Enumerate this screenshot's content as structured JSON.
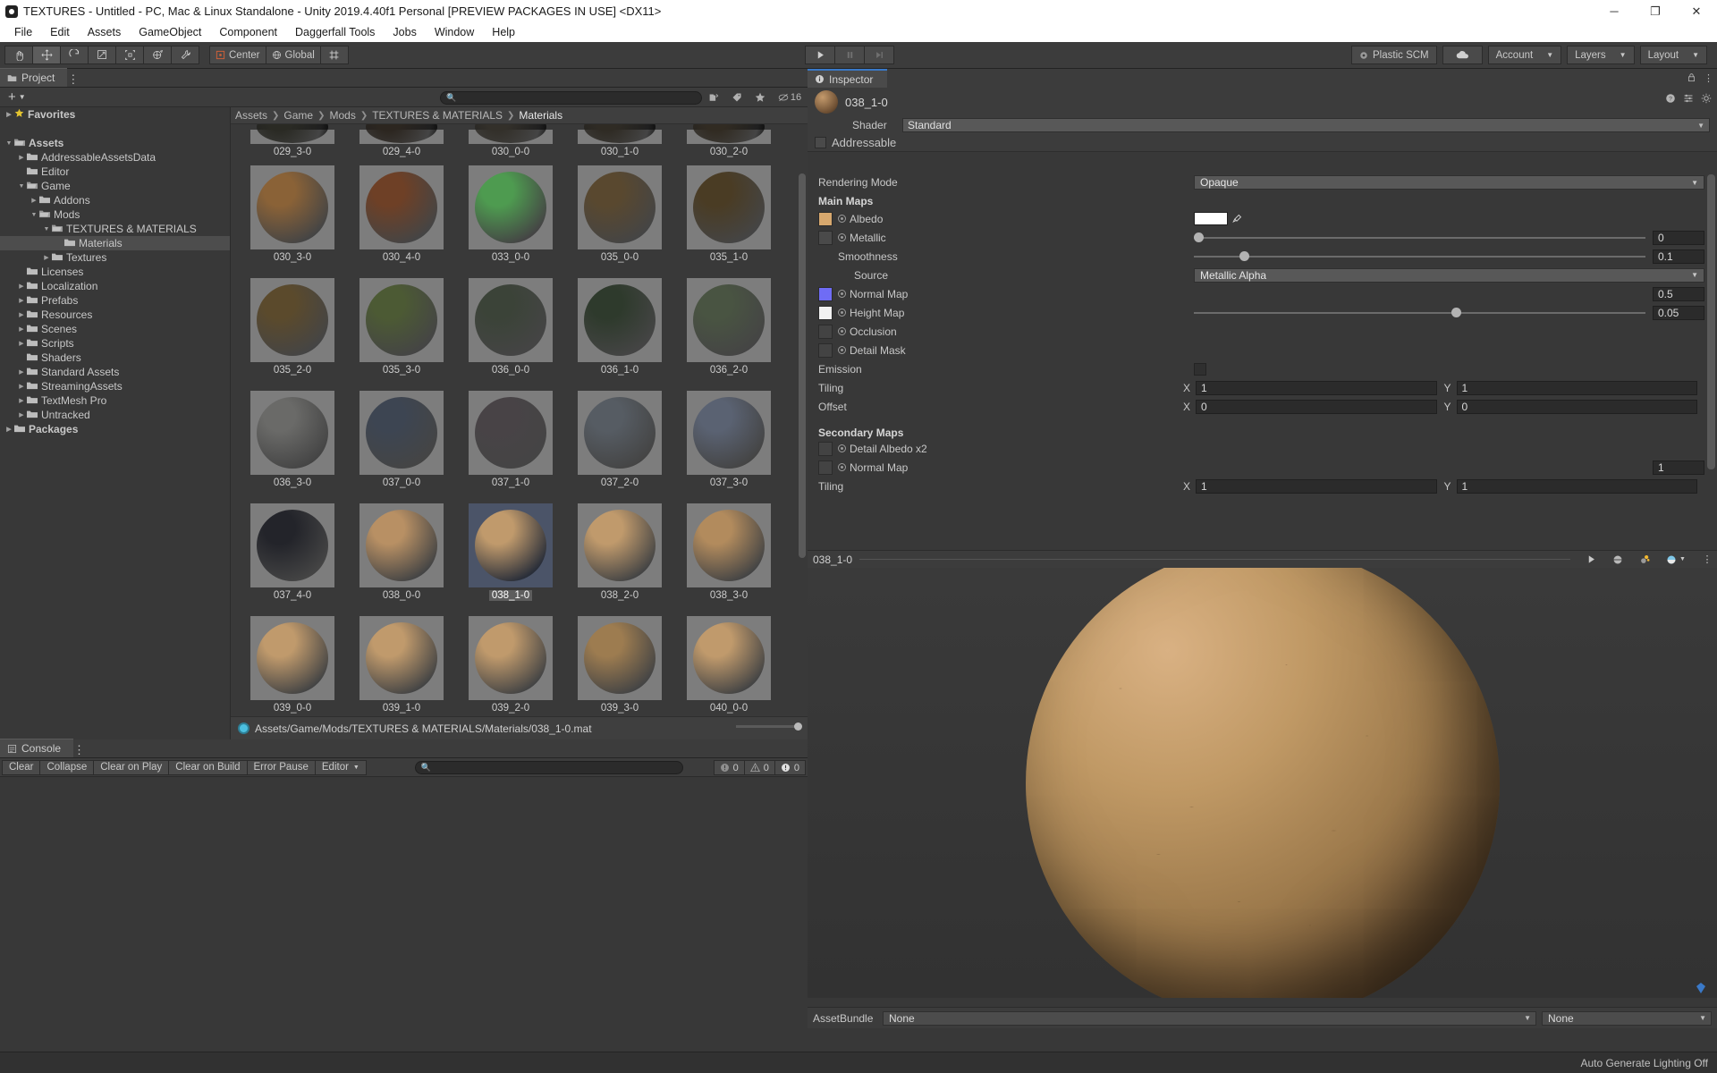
{
  "window": {
    "title": "TEXTURES - Untitled - PC, Mac & Linux Standalone - Unity 2019.4.40f1 Personal [PREVIEW PACKAGES IN USE] <DX11>",
    "minimize": "─",
    "maximize": "❐",
    "close": "✕"
  },
  "menubar": {
    "items": [
      "File",
      "Edit",
      "Assets",
      "GameObject",
      "Component",
      "Daggerfall Tools",
      "Jobs",
      "Window",
      "Help"
    ]
  },
  "toolbar": {
    "transform_tools": [
      "hand-tool",
      "move-tool",
      "rotate-tool",
      "scale-tool",
      "rect-tool",
      "transform-tool",
      "custom-tool"
    ],
    "pivot_mode": "Center",
    "pivot_rotation": "Global",
    "grid_label": "",
    "play": "▶",
    "pause": "▐▐",
    "step": "▶|",
    "plastic_scm": "Plastic SCM",
    "cloud": "cloud-icon",
    "account": "Account",
    "layers": "Layers",
    "layout": "Layout"
  },
  "project": {
    "tab": "Project",
    "create_label": "+",
    "search_placeholder": "",
    "filter_icons": [
      "search-by-type-icon",
      "search-by-label-icon",
      "favorite-icon"
    ],
    "hidden_count": "16",
    "tree": [
      {
        "label": "Favorites",
        "depth": 0,
        "arrow": "right",
        "icon": "star",
        "bold": true
      },
      {
        "label": "",
        "depth": 0,
        "arrow": "none",
        "icon": "none",
        "bold": false
      },
      {
        "label": "Assets",
        "depth": 0,
        "arrow": "down",
        "icon": "folder-open",
        "bold": true
      },
      {
        "label": "AddressableAssetsData",
        "depth": 1,
        "arrow": "right",
        "icon": "folder",
        "bold": false
      },
      {
        "label": "Editor",
        "depth": 1,
        "arrow": "none",
        "icon": "folder",
        "bold": false
      },
      {
        "label": "Game",
        "depth": 1,
        "arrow": "down",
        "icon": "folder-open",
        "bold": false
      },
      {
        "label": "Addons",
        "depth": 2,
        "arrow": "right",
        "icon": "folder",
        "bold": false
      },
      {
        "label": "Mods",
        "depth": 2,
        "arrow": "down",
        "icon": "folder-open",
        "bold": false
      },
      {
        "label": "TEXTURES & MATERIALS",
        "depth": 3,
        "arrow": "down",
        "icon": "folder-open",
        "bold": false
      },
      {
        "label": "Materials",
        "depth": 4,
        "arrow": "none",
        "icon": "folder",
        "bold": false,
        "selected": true
      },
      {
        "label": "Textures",
        "depth": 3,
        "arrow": "right",
        "icon": "folder",
        "bold": false
      },
      {
        "label": "Licenses",
        "depth": 1,
        "arrow": "none",
        "icon": "folder",
        "bold": false
      },
      {
        "label": "Localization",
        "depth": 1,
        "arrow": "right",
        "icon": "folder",
        "bold": false
      },
      {
        "label": "Prefabs",
        "depth": 1,
        "arrow": "right",
        "icon": "folder",
        "bold": false
      },
      {
        "label": "Resources",
        "depth": 1,
        "arrow": "right",
        "icon": "folder",
        "bold": false
      },
      {
        "label": "Scenes",
        "depth": 1,
        "arrow": "right",
        "icon": "folder",
        "bold": false
      },
      {
        "label": "Scripts",
        "depth": 1,
        "arrow": "right",
        "icon": "folder",
        "bold": false
      },
      {
        "label": "Shaders",
        "depth": 1,
        "arrow": "none",
        "icon": "folder",
        "bold": false
      },
      {
        "label": "Standard Assets",
        "depth": 1,
        "arrow": "right",
        "icon": "folder",
        "bold": false
      },
      {
        "label": "StreamingAssets",
        "depth": 1,
        "arrow": "right",
        "icon": "folder",
        "bold": false
      },
      {
        "label": "TextMesh Pro",
        "depth": 1,
        "arrow": "right",
        "icon": "folder",
        "bold": false
      },
      {
        "label": "Untracked",
        "depth": 1,
        "arrow": "right",
        "icon": "folder",
        "bold": false
      },
      {
        "label": "Packages",
        "depth": 0,
        "arrow": "right",
        "icon": "folder",
        "bold": true
      }
    ],
    "breadcrumb": [
      "Assets",
      "Game",
      "Mods",
      "TEXTURES & MATERIALS",
      "Materials"
    ],
    "grid": [
      {
        "name": "029_3-0",
        "color": "#2a2a24",
        "clipped": true
      },
      {
        "name": "029_4-0",
        "color": "#2c2620",
        "clipped": true
      },
      {
        "name": "030_0-0",
        "color": "#33302a",
        "clipped": true
      },
      {
        "name": "030_1-0",
        "color": "#2f2b24",
        "clipped": true
      },
      {
        "name": "030_2-0",
        "color": "#312b22",
        "clipped": true
      },
      {
        "name": "030_3-0",
        "color": "#8a6237"
      },
      {
        "name": "030_4-0",
        "color": "#6e4026"
      },
      {
        "name": "033_0-0",
        "color": "#4e9b50"
      },
      {
        "name": "035_0-0",
        "color": "#59482f"
      },
      {
        "name": "035_1-0",
        "color": "#4a3c24"
      },
      {
        "name": "035_2-0",
        "color": "#5b4a2c"
      },
      {
        "name": "035_3-0",
        "color": "#4c5a34"
      },
      {
        "name": "036_0-0",
        "color": "#3b4338"
      },
      {
        "name": "036_1-0",
        "color": "#2e3a2c"
      },
      {
        "name": "036_2-0",
        "color": "#495442"
      },
      {
        "name": "036_3-0",
        "color": "#6a6a68"
      },
      {
        "name": "037_0-0",
        "color": "#3d4552"
      },
      {
        "name": "037_1-0",
        "color": "#484346"
      },
      {
        "name": "037_2-0",
        "color": "#565c63"
      },
      {
        "name": "037_3-0",
        "color": "#5a6272"
      },
      {
        "name": "037_4-0",
        "color": "#23242a"
      },
      {
        "name": "038_0-0",
        "color": "#b89064"
      },
      {
        "name": "038_1-0",
        "color": "#c09a6c",
        "selected": true
      },
      {
        "name": "038_2-0",
        "color": "#c09a6c"
      },
      {
        "name": "038_3-0",
        "color": "#b28b5d"
      },
      {
        "name": "039_0-0",
        "color": "#c09a6c"
      },
      {
        "name": "039_1-0",
        "color": "#c09a6c"
      },
      {
        "name": "039_2-0",
        "color": "#c09a6c"
      },
      {
        "name": "039_3-0",
        "color": "#9d7c50"
      },
      {
        "name": "040_0-0",
        "color": "#c09a6c"
      },
      {
        "name": "",
        "color": "#8a6237",
        "clipped": true
      },
      {
        "name": "",
        "color": "#6b5a3a",
        "clipped": true
      },
      {
        "name": "",
        "color": "#9a7a52",
        "clipped": true
      },
      {
        "name": "",
        "color": "#8c7050",
        "clipped": true
      },
      {
        "name": "",
        "color": "#3f4a32",
        "clipped": true
      }
    ],
    "status_path": "Assets/Game/Mods/TEXTURES & MATERIALS/Materials/038_1-0.mat"
  },
  "console": {
    "tab": "Console",
    "buttons": [
      "Clear",
      "Collapse",
      "Clear on Play",
      "Clear on Build",
      "Error Pause"
    ],
    "mode": "Editor",
    "search_placeholder": "",
    "counts": {
      "log": "0",
      "warning": "0",
      "error": "0"
    }
  },
  "inspector": {
    "tab": "Inspector",
    "lock_icon": "lock-icon",
    "menu_icon": "kebab-icon",
    "help_icon": "help-icon",
    "preset_icon": "preset-icon",
    "settings_icon": "gear-icon",
    "material_name": "038_1-0",
    "shader_label": "Shader",
    "shader_value": "Standard",
    "addressable_label": "Addressable",
    "rendering_mode_label": "Rendering Mode",
    "rendering_mode_value": "Opaque",
    "main_maps_label": "Main Maps",
    "albedo_label": "Albedo",
    "albedo_color": "#ffffff",
    "albedo_swatch": "#d7a86e",
    "metallic_label": "Metallic",
    "metallic_value": "0",
    "smoothness_label": "Smoothness",
    "smoothness_value": "0.1",
    "source_label": "Source",
    "source_value": "Metallic Alpha",
    "normal_map_label": "Normal Map",
    "normal_map_value": "0.5",
    "normal_map_swatch": "#6f6cf5",
    "height_map_label": "Height Map",
    "height_map_value": "0.05",
    "height_map_swatch": "#f2f2f2",
    "occlusion_label": "Occlusion",
    "detail_mask_label": "Detail Mask",
    "emission_label": "Emission",
    "tiling_label": "Tiling",
    "tiling_x": "1",
    "tiling_y": "1",
    "offset_label": "Offset",
    "offset_x": "0",
    "offset_y": "0",
    "secondary_maps_label": "Secondary Maps",
    "detail_albedo_label": "Detail Albedo x2",
    "secondary_normal_label": "Normal Map",
    "secondary_normal_value": "1",
    "secondary_tiling_label": "Tiling",
    "secondary_tiling_x": "1",
    "secondary_tiling_y": "1",
    "preview_name": "038_1-0",
    "preview_icons": [
      "play-icon",
      "sphere-icon",
      "lighting-icon",
      "environment-icon",
      "kebab-icon"
    ],
    "assetbundle_label": "AssetBundle",
    "assetbundle_value": "None",
    "assetbundle_variant": "None"
  },
  "statusbar": {
    "text": "Auto Generate Lighting Off"
  }
}
